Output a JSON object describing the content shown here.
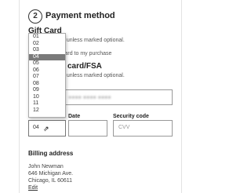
{
  "payment": {
    "step_number": "2",
    "title": "Payment method",
    "gift_card": {
      "heading": "Gift Card",
      "note": "d unless marked optional.",
      "checkbox_label": "card to my purchase"
    },
    "card": {
      "heading": "card/FSA",
      "note": "d unless marked optional.",
      "date_label": "Date",
      "security_label": "Security code",
      "cvv_placeholder": "CVV",
      "month_value": "04"
    },
    "month_options": [
      "01",
      "02",
      "03",
      "04",
      "05",
      "06",
      "07",
      "08",
      "09",
      "10",
      "11",
      "12"
    ],
    "selected_month": "04"
  },
  "billing": {
    "heading": "Billing address",
    "name": "John Newman",
    "street": "646 Michigan Ave.",
    "city": "Chicago, IL 60611",
    "edit_label": "Edit"
  },
  "colors": {
    "selected_option_bg": "#7a7a7a",
    "text": "#333333"
  }
}
